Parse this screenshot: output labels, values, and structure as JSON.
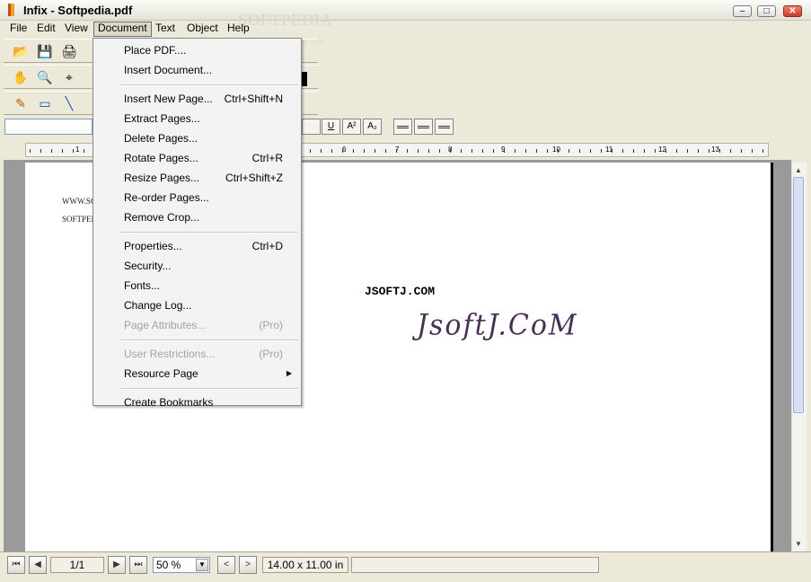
{
  "window": {
    "title": "Infix - Softpedia.pdf",
    "watermark": "SOFTPEDIA",
    "watermark_url": "www.softpedia.com"
  },
  "caption_buttons": {
    "minimize": "‒",
    "maximize": "□",
    "close": "✕"
  },
  "menubar": [
    "File",
    "Edit",
    "View",
    "Document",
    "Text",
    "Object",
    "Help"
  ],
  "document_menu": {
    "items": [
      {
        "label": "Place PDF....",
        "shortcut": "",
        "disabled": false
      },
      {
        "label": "Insert Document...",
        "shortcut": "",
        "disabled": false
      },
      {
        "separator": true
      },
      {
        "label": "Insert New Page...",
        "shortcut": "Ctrl+Shift+N",
        "disabled": false
      },
      {
        "label": "Extract Pages...",
        "shortcut": "",
        "disabled": false
      },
      {
        "label": "Delete Pages...",
        "shortcut": "",
        "disabled": false
      },
      {
        "label": "Rotate Pages...",
        "shortcut": "Ctrl+R",
        "disabled": false
      },
      {
        "label": "Resize Pages...",
        "shortcut": "Ctrl+Shift+Z",
        "disabled": false
      },
      {
        "label": "Re-order Pages...",
        "shortcut": "",
        "disabled": false
      },
      {
        "label": "Remove Crop...",
        "shortcut": "",
        "disabled": false
      },
      {
        "separator": true
      },
      {
        "label": "Properties...",
        "shortcut": "Ctrl+D",
        "disabled": false
      },
      {
        "label": "Security...",
        "shortcut": "",
        "disabled": false
      },
      {
        "label": "Fonts...",
        "shortcut": "",
        "disabled": false
      },
      {
        "label": "Change Log...",
        "shortcut": "",
        "disabled": false
      },
      {
        "label": "Page Attributes...",
        "shortcut": "(Pro)",
        "disabled": true
      },
      {
        "separator": true
      },
      {
        "label": "User Restrictions...",
        "shortcut": "(Pro)",
        "disabled": true
      },
      {
        "label": "Resource Page",
        "shortcut": "",
        "disabled": false,
        "submenu": true
      },
      {
        "separator": true
      },
      {
        "label": "Create Bookmarks",
        "shortcut": "",
        "disabled": false
      }
    ]
  },
  "format_toolbar": {
    "underline": "U",
    "superscript": "A²",
    "subscript": "A₂"
  },
  "ruler": {
    "numbers": [
      "1",
      "6",
      "7",
      "8",
      "9",
      "10",
      "11",
      "12",
      "13"
    ]
  },
  "page": {
    "snippet1": "WWW.SO",
    "snippet2": "SOFTPED",
    "plain_text": "JSOFTJ.COM",
    "script_text": "JsoftJ.CoM"
  },
  "status": {
    "page_indicator": "1/1",
    "zoom": "50 %",
    "page_size": "14.00 x 11.00 in",
    "nav_first": "⏮",
    "nav_prev": "◀",
    "nav_next": "▶",
    "nav_last": "⏭",
    "view_back": "<",
    "view_forward": ">"
  },
  "icons": {
    "open": "📂",
    "save": "💾",
    "print": "🖨",
    "hand": "✋",
    "zoom": "🔍",
    "crop": "⌖",
    "pencil": "✎",
    "rect": "▭",
    "line": "╲"
  }
}
